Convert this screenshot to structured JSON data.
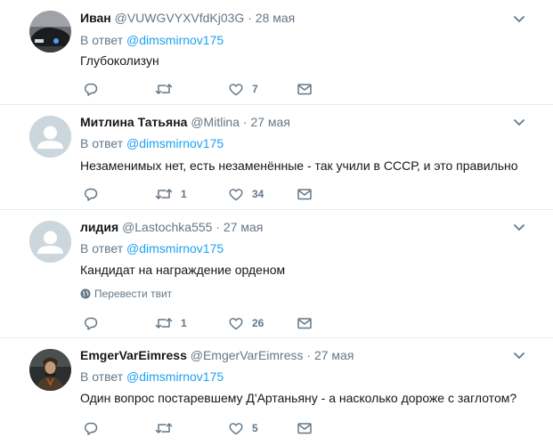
{
  "tweets": [
    {
      "name": "Иван",
      "handle": "@VUWGVYXVfdKj03G",
      "sep": "·",
      "date": "28 мая",
      "reply_prefix": "В ответ",
      "reply_to": "@dimsmirnov175",
      "text": "Глубоколизун",
      "avatar": "photo-car",
      "retweets": "",
      "likes": "7"
    },
    {
      "name": "Митлина Татьяна",
      "handle": "@Mitlina",
      "sep": "·",
      "date": "27 мая",
      "reply_prefix": "В ответ",
      "reply_to": "@dimsmirnov175",
      "text": "Незаменимых нет, есть незаменённые - так учили в СССР, и это правильно",
      "avatar": "default-egg",
      "retweets": "1",
      "likes": "34"
    },
    {
      "name": "лидия",
      "handle": "@Lastochka555",
      "sep": "·",
      "date": "27 мая",
      "reply_prefix": "В ответ",
      "reply_to": "@dimsmirnov175",
      "text": "Кандидат на награждение орденом",
      "translate": "Перевести твит",
      "avatar": "default-egg",
      "retweets": "1",
      "likes": "26"
    },
    {
      "name": "EmgerVarEimress",
      "handle": "@EmgerVarEimress",
      "sep": "·",
      "date": "27 мая",
      "reply_prefix": "В ответ",
      "reply_to": "@dimsmirnov175",
      "text": "Один вопрос постаревшему Д'Артаньяну - а насколько дороже с заглотом?",
      "avatar": "photo-musketeer",
      "retweets": "",
      "likes": "5"
    }
  ],
  "colors": {
    "link": "#1da1f2",
    "secondary": "#657786",
    "text": "#14171a",
    "divider": "#e6ecf0",
    "default_avatar_bg": "#ccd6dd"
  },
  "icons": [
    "reply-icon",
    "retweet-icon",
    "like-icon",
    "direct-message-icon",
    "caret-down-icon",
    "globe-icon"
  ]
}
